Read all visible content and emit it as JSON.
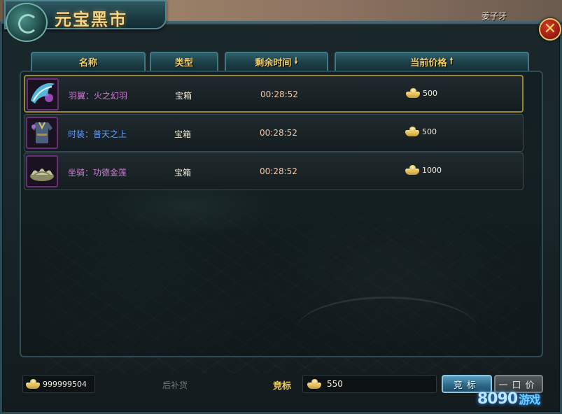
{
  "window": {
    "title": "元宝黑市",
    "player_name": "姜子牙"
  },
  "columns": [
    {
      "label": "名称",
      "sort_icon": ""
    },
    {
      "label": "类型",
      "sort_icon": ""
    },
    {
      "label": "剩余时间",
      "sort_icon": "arrow-down-icon"
    },
    {
      "label": "当前价格",
      "sort_icon": "arrow-up-icon"
    }
  ],
  "items": [
    {
      "name": "羽翼：火之幻羽",
      "name_color": "#d47bd8",
      "type": "宝箱",
      "time_left": "00:28:52",
      "price": "500",
      "icon": "wing-icon",
      "selected": true
    },
    {
      "name": "时装：普天之上",
      "name_color": "#6a9df0",
      "type": "宝箱",
      "time_left": "00:28:52",
      "price": "500",
      "icon": "costume-icon",
      "selected": false
    },
    {
      "name": "坐骑：功德金莲",
      "name_color": "#d47bd8",
      "type": "宝箱",
      "time_left": "00:28:52",
      "price": "1000",
      "icon": "lotus-mount-icon",
      "selected": false
    }
  ],
  "footer": {
    "gold_balance": "999999504",
    "restock_label": "后补货",
    "bid_label": "竞标",
    "bid_value": "550",
    "bid_button": "竞标",
    "buyout_button": "一口价"
  },
  "watermark": {
    "text": "8090",
    "suffix": "游戏"
  }
}
